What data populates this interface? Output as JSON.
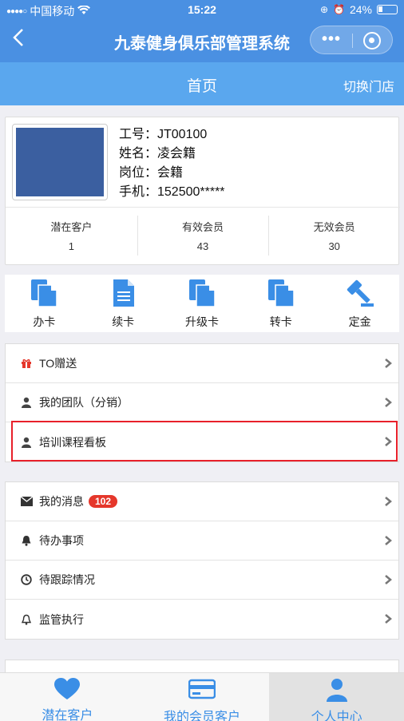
{
  "status": {
    "carrier": "中国移动",
    "time": "15:22",
    "battery": "24%"
  },
  "nav": {
    "title": "九泰健身俱乐部管理系统",
    "back_icon": "chevron-left-icon",
    "menu_icon": "more-dots-icon",
    "close_icon": "target-circle-icon"
  },
  "subbar": {
    "page_title": "首页",
    "switch_store": "切换门店"
  },
  "profile": {
    "employee_id": "工号：JT00100",
    "name": "姓名：凌会籍",
    "position": "岗位：会籍",
    "phone": "手机：152500*****",
    "stats": [
      {
        "label": "潜在客户",
        "value": "1"
      },
      {
        "label": "有效会员",
        "value": "43"
      },
      {
        "label": "无效会员",
        "value": "30"
      }
    ]
  },
  "actions": [
    {
      "label": "办卡",
      "icon": "document-icon"
    },
    {
      "label": "续卡",
      "icon": "document-lines-icon"
    },
    {
      "label": "升级卡",
      "icon": "document-icon"
    },
    {
      "label": "转卡",
      "icon": "document-icon"
    },
    {
      "label": "定金",
      "icon": "gavel-icon"
    }
  ],
  "menu1": [
    {
      "label": "TO赠送",
      "icon": "gift-icon"
    },
    {
      "label": "我的团队（分销）",
      "icon": "user-icon"
    },
    {
      "label": "培训课程看板",
      "icon": "user-icon"
    }
  ],
  "menu2": [
    {
      "label": "我的消息",
      "icon": "envelope-icon",
      "badge": "102"
    },
    {
      "label": "待办事项",
      "icon": "bell-icon"
    },
    {
      "label": "待跟踪情况",
      "icon": "clock-icon"
    },
    {
      "label": "监管执行",
      "icon": "bell-outline-icon"
    }
  ],
  "tabs": [
    {
      "label": "潜在客户",
      "icon": "heart-icon"
    },
    {
      "label": "我的会员客户",
      "icon": "card-icon"
    },
    {
      "label": "个人中心",
      "icon": "person-icon"
    }
  ],
  "colors": {
    "nav_bg": "#4a90e2",
    "subbar_bg": "#5aa7ee",
    "accent": "#3a8ee6",
    "badge": "#e5372b",
    "highlight": "#e8202a"
  }
}
